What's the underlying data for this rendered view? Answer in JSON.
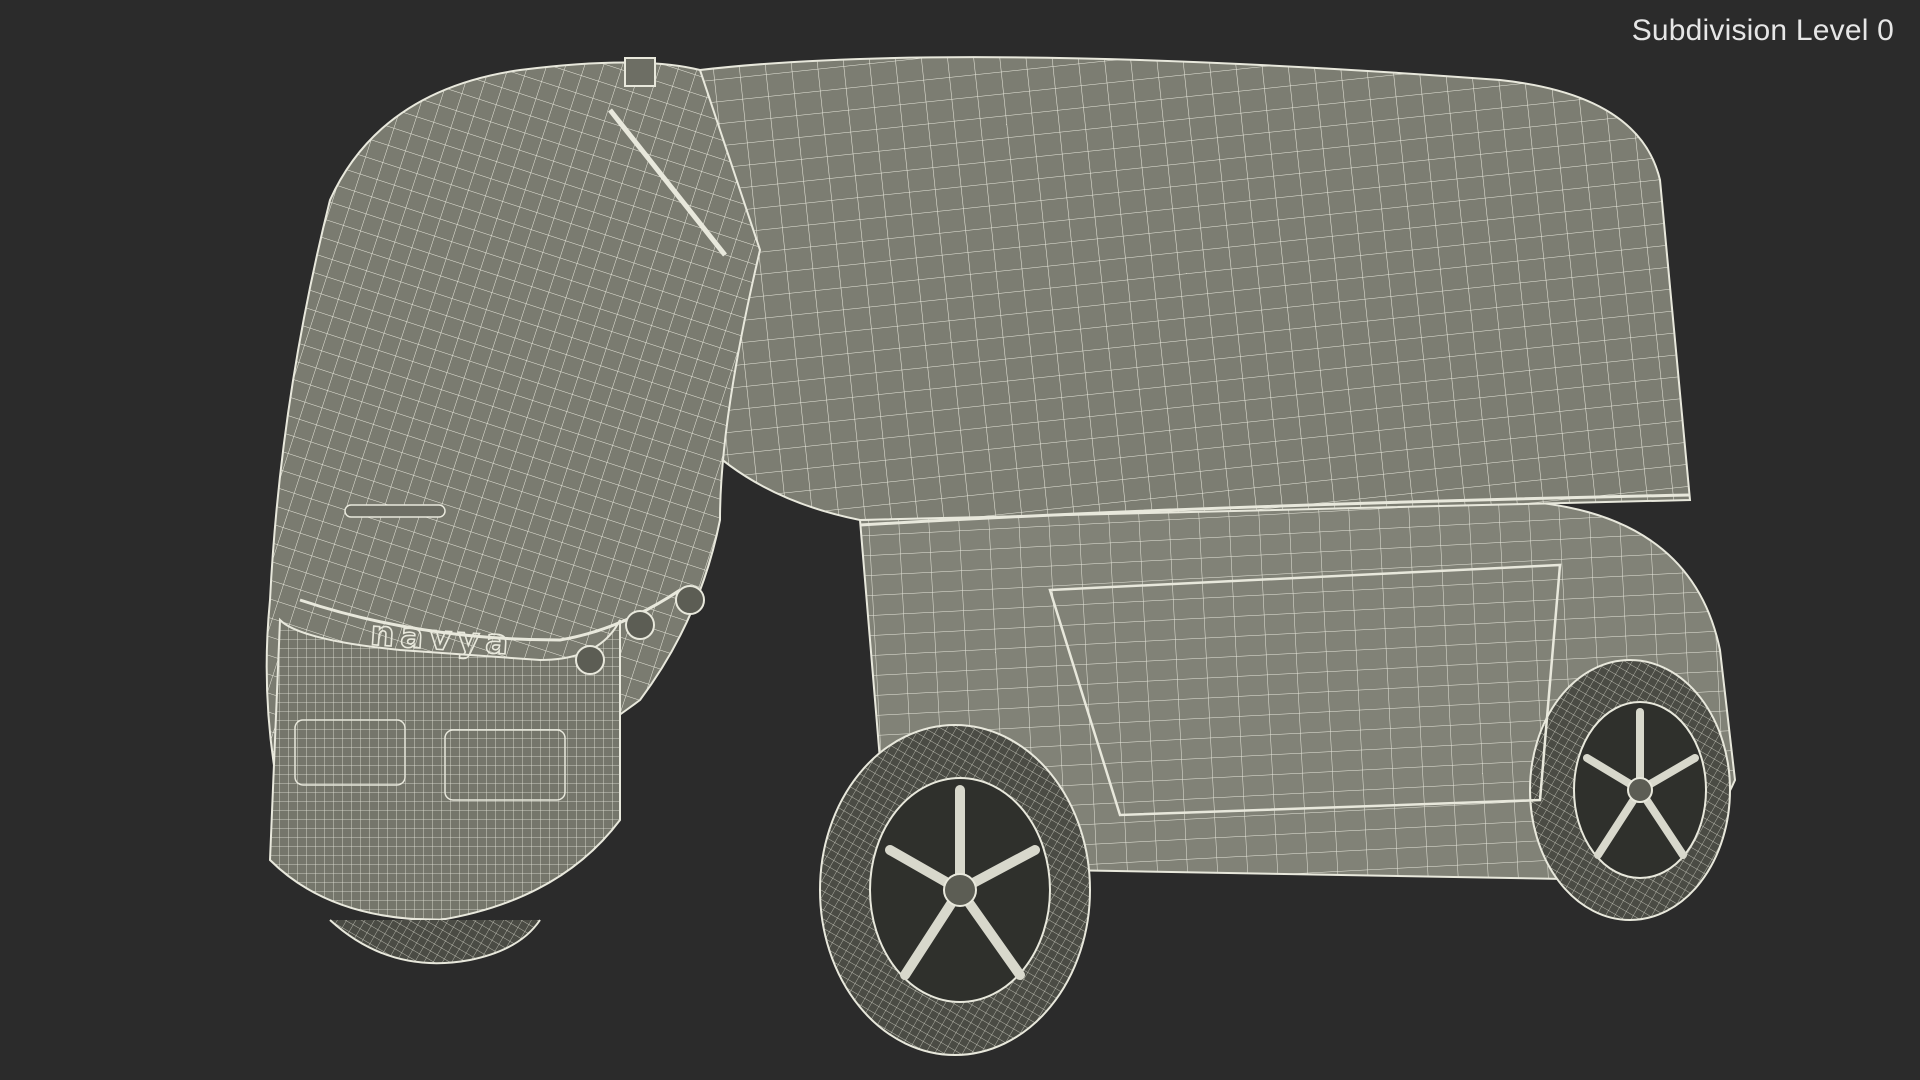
{
  "viewport": {
    "label": "Subdivision Level 0",
    "background_color": "#2b2b2b",
    "label_color": "#e6e6e6"
  },
  "model": {
    "brand_lettering": "navya",
    "surface_color": "#7f8075",
    "wire_color": "#e8e8dc",
    "wheel_color": "#2f302c"
  }
}
